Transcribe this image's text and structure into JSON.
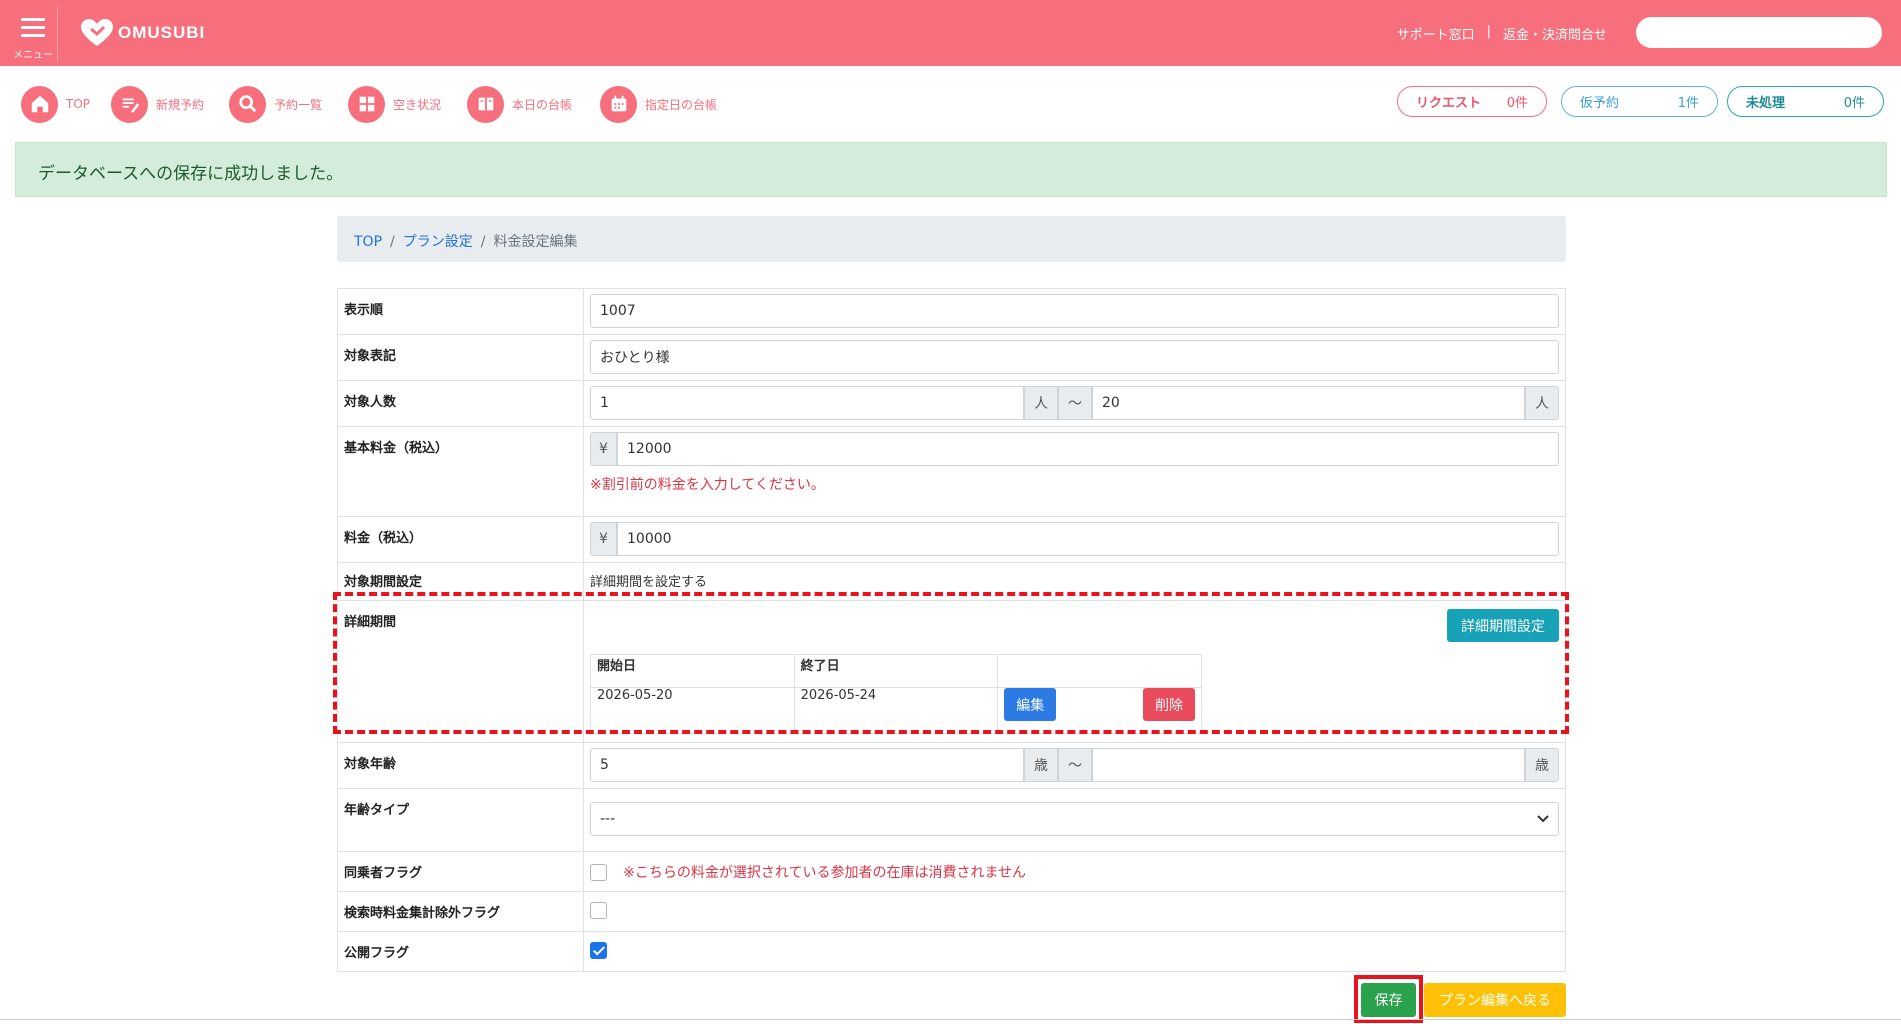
{
  "header": {
    "menu_label": "メニュー",
    "logo_text": "OMUSUBI",
    "links": [
      "サポート窓口",
      "|",
      "返金・決済問合せ"
    ],
    "search_placeholder": "",
    "color": "#f76f7c"
  },
  "nav": {
    "items": [
      {
        "label": "TOP",
        "icon": "home-icon"
      },
      {
        "label": "新規予約",
        "icon": "edit-icon"
      },
      {
        "label": "予約一覧",
        "icon": "search-icon"
      },
      {
        "label": "空き状況",
        "icon": "grid-icon"
      },
      {
        "label": "本日の台帳",
        "icon": "book-icon"
      },
      {
        "label": "指定日の台帳",
        "icon": "calendar-icon"
      }
    ],
    "counters": [
      {
        "label": "リクエスト",
        "count": "0件"
      },
      {
        "label": "仮予約",
        "count": "1件"
      },
      {
        "label": "未処理",
        "count": "0件"
      }
    ]
  },
  "alert": {
    "message": "データベースへの保存に成功しました。"
  },
  "breadcrumb": {
    "items": [
      "TOP",
      "プラン設定",
      "料金設定編集"
    ],
    "separator": "/"
  },
  "form": {
    "display_order": {
      "label": "表示順",
      "value": "1007"
    },
    "target_notation": {
      "label": "対象表記",
      "value": "おひとり様"
    },
    "target_count": {
      "label": "対象人数",
      "min": "1",
      "max": "20",
      "unit": "人",
      "tilde": "～"
    },
    "base_price": {
      "label": "基本料金（税込）",
      "currency": "¥",
      "value": "12000",
      "hint": "※割引前の料金を入力してください。"
    },
    "price": {
      "label": "料金（税込）",
      "currency": "¥",
      "value": "10000"
    },
    "period_setting": {
      "label": "対象期間設定",
      "value": "詳細期間を設定する"
    },
    "detail_period": {
      "label": "詳細期間",
      "set_button": "詳細期間設定",
      "headers": [
        "開始日",
        "終了日",
        ""
      ],
      "rows": [
        {
          "start": "2026-05-20",
          "end": "2026-05-24",
          "edit": "編集",
          "delete": "削除"
        }
      ]
    },
    "target_age": {
      "label": "対象年齢",
      "min": "5",
      "max": "",
      "unit": "歳",
      "tilde": "～"
    },
    "age_type": {
      "label": "年齢タイプ",
      "selected": "---"
    },
    "companion_flag": {
      "label": "同乗者フラグ",
      "checked": false,
      "note": "※こちらの料金が選択されている参加者の在庫は消費されません"
    },
    "search_exclude_flag": {
      "label": "検索時料金集計除外フラグ",
      "checked": false
    },
    "public_flag": {
      "label": "公開フラグ",
      "checked": true
    }
  },
  "actions": {
    "save": "保存",
    "back": "プラン編集へ戻る"
  }
}
